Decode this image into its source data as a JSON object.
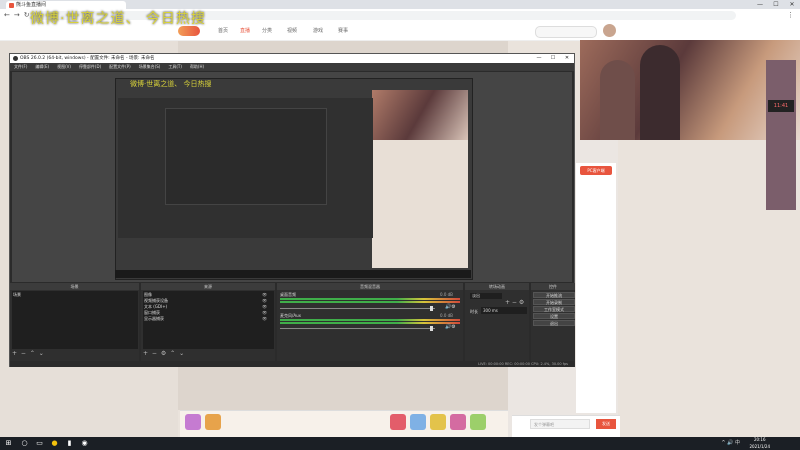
{
  "overlay_text": "微博·世离之道、 今日热搜",
  "browser": {
    "tab_title": "熊斗鱼直播间",
    "url": "",
    "controls": [
      "—",
      "☐",
      "✕"
    ],
    "nav": [
      "←",
      "→",
      "↻"
    ],
    "menu": "⋮"
  },
  "site": {
    "nav_links": [
      "首页",
      "直播",
      "分类",
      "视频",
      "游戏",
      "赛事"
    ],
    "promo_badge": "PC客户端",
    "side_timer": "11:41",
    "chat_placeholder": "发个弹幕吧",
    "send_label": "发送"
  },
  "obs": {
    "title": "OBS 26.0.2 (64-bit, windows) - 配置文件: 未命名 - 场景: 未命名",
    "controls": [
      "—",
      "☐",
      "✕"
    ],
    "menu": [
      "文件(F)",
      "编辑(E)",
      "视图(V)",
      "停靠部件(D)",
      "配置文件(P)",
      "场景集合(S)",
      "工具(T)",
      "帮助(H)"
    ],
    "nested_text": "微博·世离之道、 今日热搜",
    "docks": {
      "scenes": {
        "title": "场景",
        "items": [
          "场景"
        ]
      },
      "sources": {
        "title": "来源",
        "items": [
          "图像",
          "视频捕获设备",
          "文本 (GDI+)",
          "窗口捕获",
          "显示器捕获"
        ]
      },
      "mixer": {
        "title": "音频混音器",
        "tracks": [
          {
            "name": "桌面音频",
            "db": "0.0 dB"
          },
          {
            "name": "麦克风/Aux",
            "db": "0.0 dB"
          }
        ]
      },
      "transitions": {
        "title": "转场动画",
        "type": "淡出",
        "duration_label": "时长",
        "duration": "300 ms"
      },
      "controls": {
        "title": "控件",
        "buttons": [
          "开始推流",
          "开始录制",
          "工作室模式",
          "设置",
          "退出"
        ]
      }
    },
    "status": "LIVE: 00:00:00    REC: 00:00:00    CPU: 2.4%, 30.00 fps"
  },
  "taskbar": {
    "time": "20:16",
    "date": "2021/1/24",
    "tray": "^ 🔊 中"
  }
}
